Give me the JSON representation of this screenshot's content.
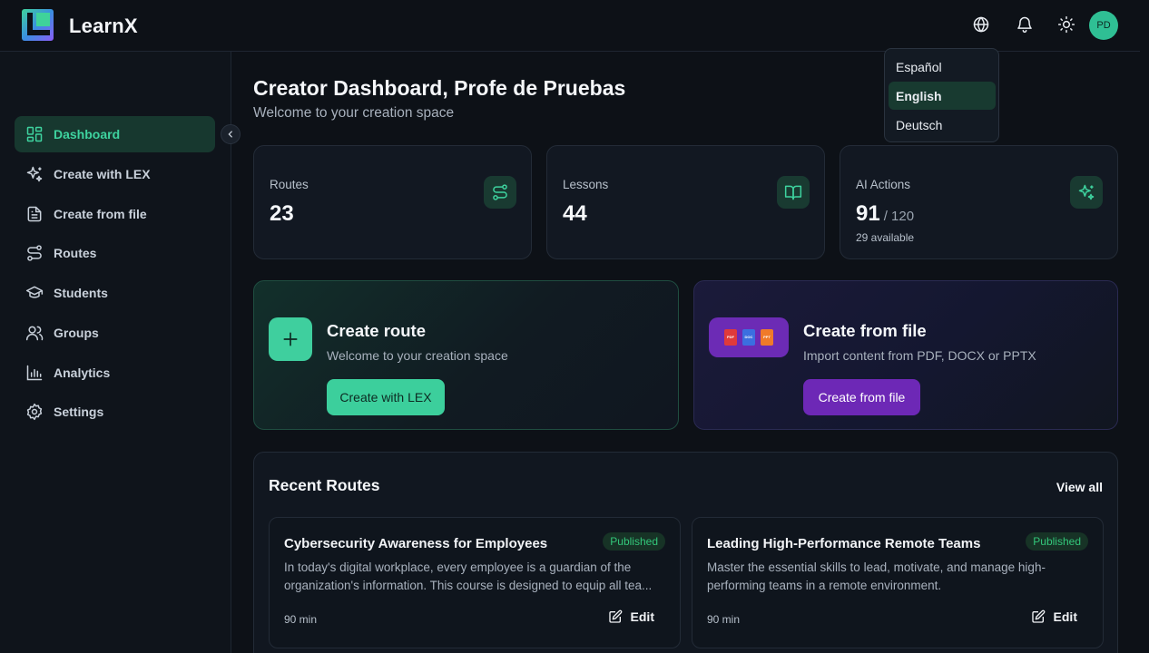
{
  "app": {
    "name": "LearnX"
  },
  "header": {
    "avatar_initials": "PD"
  },
  "language_menu": {
    "options": [
      "Español",
      "English",
      "Deutsch"
    ],
    "selected": "English"
  },
  "sidebar": {
    "items": [
      {
        "label": "Dashboard",
        "icon": "dashboard-icon",
        "active": true
      },
      {
        "label": "Create with LEX",
        "icon": "sparkles-icon"
      },
      {
        "label": "Create from file",
        "icon": "file-text-icon"
      },
      {
        "label": "Routes",
        "icon": "route-icon"
      },
      {
        "label": "Students",
        "icon": "graduation-cap-icon"
      },
      {
        "label": "Groups",
        "icon": "users-icon"
      },
      {
        "label": "Analytics",
        "icon": "bar-chart-icon"
      },
      {
        "label": "Settings",
        "icon": "gear-icon"
      }
    ]
  },
  "main": {
    "title": "Creator Dashboard, Profe de Pruebas",
    "subtitle": "Welcome to your creation space",
    "stats": {
      "routes": {
        "label": "Routes",
        "value": "23"
      },
      "lessons": {
        "label": "Lessons",
        "value": "44"
      },
      "ai_actions": {
        "label": "AI Actions",
        "value": "91",
        "of": "/ 120",
        "note": "29 available"
      }
    },
    "create_route": {
      "title": "Create route",
      "description": "Welcome to your creation space",
      "button": "Create with LEX"
    },
    "create_file": {
      "title": "Create from file",
      "description": "Import content from PDF, DOCX or PPTX",
      "button": "Create from file",
      "file_types": [
        "PDF",
        "DOC",
        "PPT"
      ]
    },
    "recent": {
      "title": "Recent Routes",
      "view_all": "View all",
      "routes": [
        {
          "title": "Cybersecurity Awareness for Employees",
          "status": "Published",
          "desc_line1": "In today's digital workplace, every employee is a guardian of the",
          "desc_line2": "organization's information. This course is designed to equip all tea...",
          "duration": "90 min",
          "edit": "Edit"
        },
        {
          "title": "Leading High-Performance Remote Teams",
          "status": "Published",
          "desc_line1": "Master the essential skills to lead, motivate, and manage high-",
          "desc_line2": "performing teams in a remote environment.",
          "duration": "90 min",
          "edit": "Edit"
        }
      ]
    }
  },
  "colors": {
    "accent": "#3ccf9c",
    "purple": "#6d28b6",
    "background": "#0d1117"
  }
}
